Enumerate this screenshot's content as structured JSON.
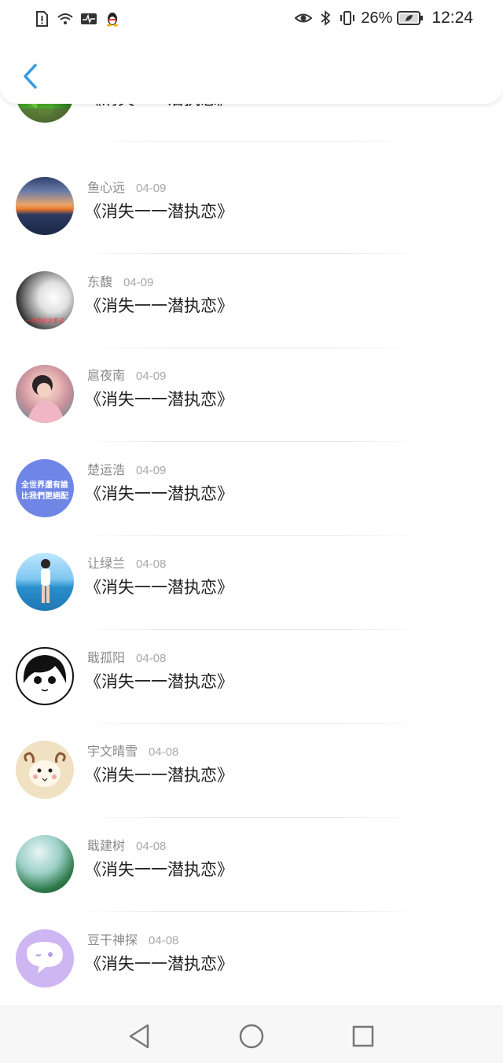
{
  "status_bar": {
    "battery_percent": "26%",
    "time": "12:24"
  },
  "messages": [
    {
      "name": "",
      "date": "",
      "text": "《消失一一潜执恋》"
    },
    {
      "name": "鱼心远",
      "date": "04-09",
      "text": "《消失一一潜执恋》"
    },
    {
      "name": "东馥",
      "date": "04-09",
      "text": "《消失一一潜执恋》"
    },
    {
      "name": "扈夜南",
      "date": "04-09",
      "text": "《消失一一潜执恋》"
    },
    {
      "name": "楚运浩",
      "date": "04-09",
      "text": "《消失一一潜执恋》"
    },
    {
      "name": "让绿兰",
      "date": "04-08",
      "text": "《消失一一潜执恋》"
    },
    {
      "name": "戢孤阳",
      "date": "04-08",
      "text": "《消失一一潜执恋》"
    },
    {
      "name": "宇文晴雪",
      "date": "04-08",
      "text": "《消失一一潜执恋》"
    },
    {
      "name": "戢建树",
      "date": "04-08",
      "text": "《消失一一潜执恋》"
    },
    {
      "name": "豆干神探",
      "date": "04-08",
      "text": "《消失一一潜执恋》"
    }
  ],
  "avatar_texts": {
    "row2": "一类我们没爱过",
    "row4_line1": "全世界還有誰",
    "row4_line2": "比我們更絕配"
  },
  "colors": {
    "accent": "#3a9be0",
    "name_gray": "#8a8a8a",
    "date_gray": "#a8a8a8"
  },
  "icons": {
    "back": "chevron-left-icon",
    "nav_back": "triangle-back-icon",
    "nav_home": "circle-home-icon",
    "nav_recent": "square-recent-icon"
  }
}
